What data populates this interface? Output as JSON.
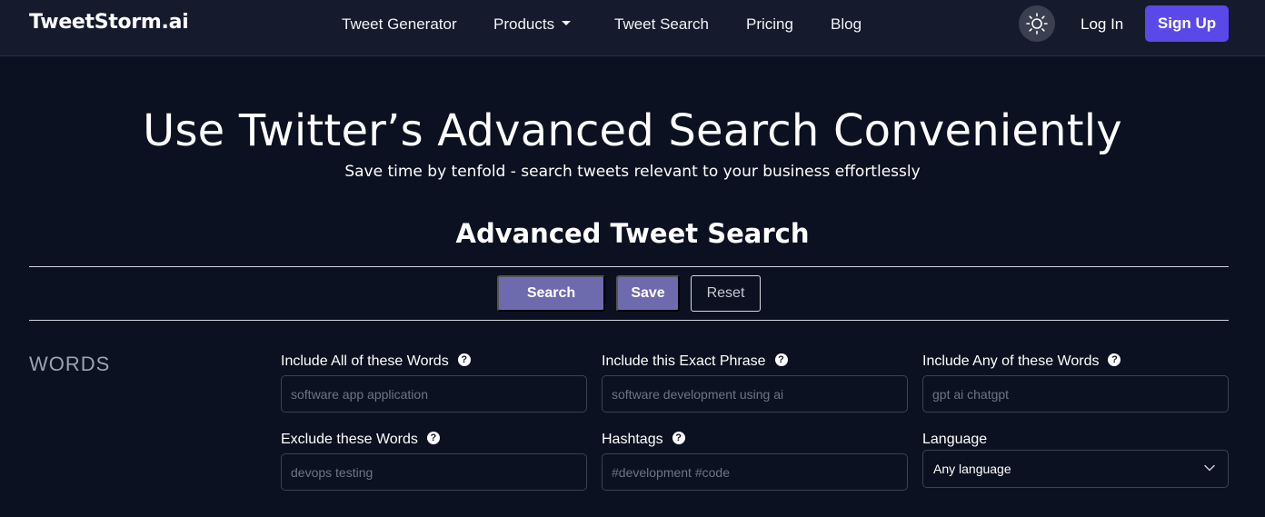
{
  "brand": "TweetStorm.ai",
  "nav": {
    "items": [
      {
        "label": "Tweet Generator"
      },
      {
        "label": "Products"
      },
      {
        "label": "Tweet Search"
      },
      {
        "label": "Pricing"
      },
      {
        "label": "Blog"
      }
    ],
    "login_label": "Log In",
    "signup_label": "Sign Up",
    "theme_icon": "sun-icon"
  },
  "hero": {
    "title": "Use Twitter’s Advanced Search Conveniently",
    "subtitle": "Save time by tenfold - search tweets relevant to your business effortlessly"
  },
  "search": {
    "title": "Advanced Tweet Search",
    "buttons": {
      "search": "Search",
      "save": "Save",
      "reset": "Reset"
    },
    "group_label": "WORDS",
    "fields": {
      "include_all": {
        "label": "Include All of these Words",
        "placeholder": "software app application",
        "value": ""
      },
      "exact_phrase": {
        "label": "Include this Exact Phrase",
        "placeholder": "software development using ai",
        "value": ""
      },
      "include_any": {
        "label": "Include Any of these Words",
        "placeholder": "gpt ai chatgpt",
        "value": ""
      },
      "exclude": {
        "label": "Exclude these Words",
        "placeholder": "devops testing",
        "value": ""
      },
      "hashtags": {
        "label": "Hashtags",
        "placeholder": "#development #code",
        "value": ""
      },
      "language": {
        "label": "Language",
        "selected": "Any language"
      }
    },
    "help_glyph": "?"
  },
  "colors": {
    "background": "#0b1120",
    "navbar": "#151b2c",
    "accent": "#5a49e8",
    "button": "#6e6aae"
  }
}
